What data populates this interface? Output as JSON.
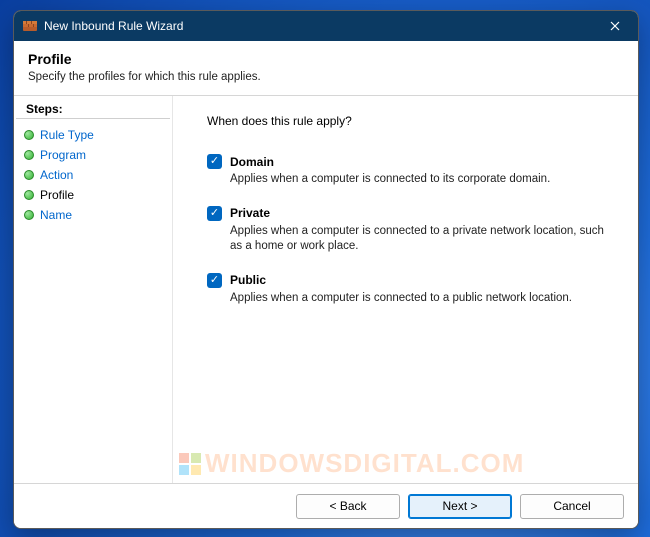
{
  "window": {
    "title": "New Inbound Rule Wizard"
  },
  "header": {
    "title": "Profile",
    "subtitle": "Specify the profiles for which this rule applies."
  },
  "sidebar": {
    "stepsTitle": "Steps:",
    "steps": [
      {
        "label": "Rule Type",
        "current": false
      },
      {
        "label": "Program",
        "current": false
      },
      {
        "label": "Action",
        "current": false
      },
      {
        "label": "Profile",
        "current": true
      },
      {
        "label": "Name",
        "current": false
      }
    ]
  },
  "content": {
    "question": "When does this rule apply?",
    "options": [
      {
        "label": "Domain",
        "description": "Applies when a computer is connected to its corporate domain.",
        "checked": true
      },
      {
        "label": "Private",
        "description": "Applies when a computer is connected to a private network location, such as a home or work place.",
        "checked": true
      },
      {
        "label": "Public",
        "description": "Applies when a computer is connected to a public network location.",
        "checked": true
      }
    ]
  },
  "footer": {
    "back": "< Back",
    "next": "Next >",
    "cancel": "Cancel"
  },
  "watermark": "WINDOWSDIGITAL.COM"
}
